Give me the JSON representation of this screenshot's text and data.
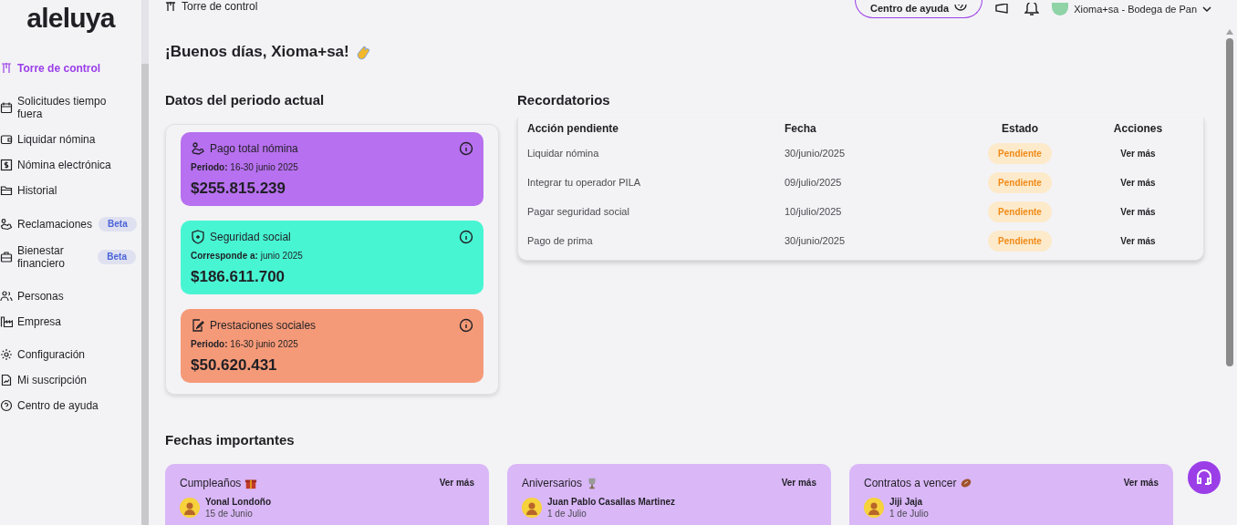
{
  "logo": "aleluya",
  "header": {
    "breadcrumb": "Torre de control",
    "help_button": "Centro de ayuda",
    "user": "Xioma+sa - Bodega de Pan"
  },
  "sidebar": {
    "groups": [
      {
        "items": [
          {
            "label": "Torre de control",
            "selected": true
          }
        ]
      },
      {
        "items": [
          {
            "label": "Solicitudes tiempo fuera",
            "selected": false
          },
          {
            "label": "Liquidar nómina",
            "selected": false
          },
          {
            "label": "Nómina electrónica",
            "selected": false
          },
          {
            "label": "Historial",
            "selected": false
          }
        ]
      },
      {
        "items": [
          {
            "label": "Reclamaciones",
            "selected": false,
            "badge": "Beta"
          },
          {
            "label": "Bienestar financiero",
            "selected": false,
            "badge": "Beta"
          }
        ]
      },
      {
        "items": [
          {
            "label": "Personas",
            "selected": false
          },
          {
            "label": "Empresa",
            "selected": false
          }
        ]
      },
      {
        "items": [
          {
            "label": "Configuración",
            "selected": false
          },
          {
            "label": "Mi suscripción",
            "selected": false
          },
          {
            "label": "Centro de ayuda",
            "selected": false
          }
        ]
      }
    ]
  },
  "greeting": "¡Buenos días, Xioma+sa!",
  "period": {
    "title": "Datos del periodo actual",
    "cards": [
      {
        "title": "Pago total nómina",
        "detail": "**Periodo:** 16-30 junio 2025",
        "amount": "$255.815.239",
        "color": "#b770ef"
      },
      {
        "title": "Seguridad social",
        "detail": "**Corresponde a:** junio 2025",
        "amount": "$186.611.700",
        "color": "#48f5d3"
      },
      {
        "title": "Prestaciones sociales",
        "detail": "**Periodo:** 16-30 junio 2025",
        "amount": "$50.620.431",
        "color": "#f59a78"
      }
    ]
  },
  "reminders": {
    "title": "Recordatorios",
    "columns": [
      "Acción pendiente",
      "Fecha",
      "Estado",
      "Acciones"
    ],
    "rows": [
      {
        "action": "Liquidar nómina",
        "date": "30/junio/2025",
        "status": "Pendiente",
        "link": "Ver más"
      },
      {
        "action": "Integrar tu operador PILA",
        "date": "09/julio/2025",
        "status": "Pendiente",
        "link": "Ver más"
      },
      {
        "action": "Pagar seguridad social",
        "date": "10/julio/2025",
        "status": "Pendiente",
        "link": "Ver más"
      },
      {
        "action": "Pago de prima",
        "date": "30/junio/2025",
        "status": "Pendiente",
        "link": "Ver más"
      }
    ]
  },
  "dates": {
    "title": "Fechas importantes",
    "cards": [
      {
        "kind": "gift",
        "title": "Cumpleaños",
        "link": "Ver más",
        "name": "Yonal Londoño",
        "date": "15 de Junio"
      },
      {
        "kind": "trophy",
        "title": "Aniversarios",
        "link": "Ver más",
        "name": "Juan Pablo Casallas Martinez",
        "date": "1 de Julio"
      },
      {
        "kind": "ball",
        "title": "Contratos a vencer",
        "link": "Ver más",
        "name": "Jiji Jaja",
        "date": "1 de Julio"
      }
    ]
  }
}
